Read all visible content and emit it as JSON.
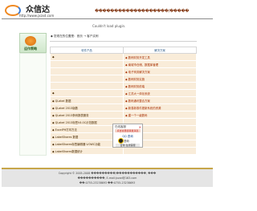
{
  "header": {
    "site_name": "众信达",
    "site_url": "http://www.jxzxd.com",
    "notice": "�������������������/�����"
  },
  "plugin_message": "Couldn't load plugin.",
  "sidebar": {
    "badge_label": "运作策略"
  },
  "breadcrumb": "◆ 您现在的位置是：首页 → 客户实例",
  "table": {
    "headers": [
      "软件产品",
      "解决方案"
    ],
    "rows": [
      {
        "product": "◆",
        "solution": "◆ 数码财务开发工具"
      },
      {
        "product": "",
        "solution": "◆ 南城市仓储、数据库管理"
      },
      {
        "product": "",
        "solution": "◆ 电子商务解决方案"
      },
      {
        "product": "",
        "solution": "◆ 数码财务实施"
      },
      {
        "product": "",
        "solution": "◆ 数码财务前端"
      },
      {
        "product": "◆ ",
        "solution": "◆ 江苏大一体化系统"
      },
      {
        "product": "◆ QLabel 数据",
        "solution": "◆ 数码通讯整合方案"
      },
      {
        "product": "◆ QLabel 2013版数",
        "solution": "◆ 新易新零件更新系统的资源"
      },
      {
        "product": "◆ QLabel 2013条码报表服务",
        "solution": "◆ 建一个一级数码"
      },
      {
        "product": "◆ QLabel 2013标签V4.0C示范数据",
        "solution": ""
      },
      {
        "product": "◆ ExcelPH打印方法",
        "solution": ""
      },
      {
        "product": "◆ LabelShares 数据",
        "solution": ""
      },
      {
        "product": "◆ LabelShares标签编辑器 V.0WC功能",
        "solution": ""
      },
      {
        "product": "◆ LabelShares数据统计",
        "solution": ""
      }
    ]
  },
  "popup": {
    "title": "在线客服",
    "close": "×",
    "bar": "点击这里给我发消息",
    "qq_text": "QQ 咨询",
    "qq_label": "咨询",
    "footer": "咨询 在线客服"
  },
  "footer": {
    "line1": "Copyright © 2005-2008 ���������/�����������, ���",
    "line2": "����������, E-mail:jxzxd@163.com",
    "line3": "��:0755-23238693 ��:0755-23238693"
  }
}
